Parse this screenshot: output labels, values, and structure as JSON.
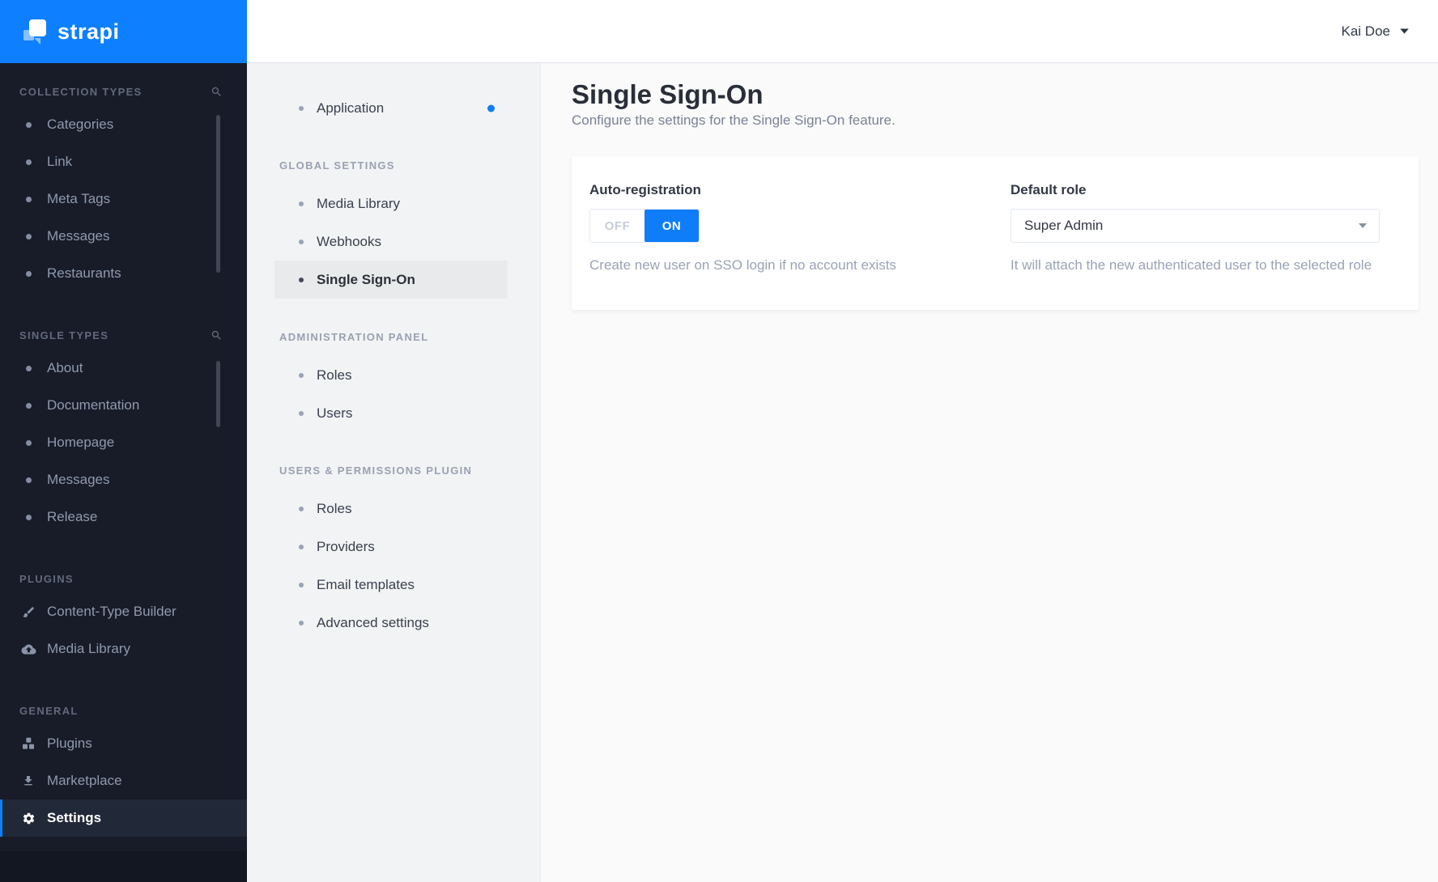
{
  "brand": {
    "name": "strapi"
  },
  "colors": {
    "brand_blue": "#0e80ff",
    "accent": "#0e7df7",
    "sidebar_bg": "#171c28",
    "settings_sidebar_bg": "#f2f3f4",
    "selected_row_bg": "#e9eaeb"
  },
  "icons": {
    "search": "magnifier",
    "content_type_builder": "brush-icon",
    "media_library": "cloud-upload-icon",
    "plugins": "cubes-icon",
    "marketplace": "download-icon",
    "settings": "gear-icon",
    "user_menu": "caret-down-icon",
    "dropdown": "caret-down-icon"
  },
  "topbar": {
    "user_name": "Kai Doe"
  },
  "sidebar": {
    "sections": [
      {
        "title": "COLLECTION TYPES",
        "has_search": true,
        "items": [
          {
            "label": "Categories"
          },
          {
            "label": "Link"
          },
          {
            "label": "Meta Tags"
          },
          {
            "label": "Messages"
          },
          {
            "label": "Restaurants"
          }
        ]
      },
      {
        "title": "SINGLE TYPES",
        "has_search": true,
        "items": [
          {
            "label": "About"
          },
          {
            "label": "Documentation"
          },
          {
            "label": "Homepage"
          },
          {
            "label": "Messages"
          },
          {
            "label": "Release"
          }
        ]
      },
      {
        "title": "PLUGINS",
        "items": [
          {
            "label": "Content-Type Builder",
            "icon": "brush-icon"
          },
          {
            "label": "Media Library",
            "icon": "cloud-upload-icon"
          }
        ]
      },
      {
        "title": "GENERAL",
        "items": [
          {
            "label": "Plugins",
            "icon": "cubes-icon"
          },
          {
            "label": "Marketplace",
            "icon": "download-icon"
          },
          {
            "label": "Settings",
            "icon": "gear-icon",
            "active": true
          }
        ]
      }
    ]
  },
  "settings_menu": {
    "groups": [
      {
        "title": "",
        "items": [
          {
            "label": "Application",
            "notification": true
          }
        ]
      },
      {
        "title": "GLOBAL SETTINGS",
        "items": [
          {
            "label": "Media Library"
          },
          {
            "label": "Webhooks"
          },
          {
            "label": "Single Sign-On",
            "selected": true
          }
        ]
      },
      {
        "title": "ADMINISTRATION PANEL",
        "items": [
          {
            "label": "Roles"
          },
          {
            "label": "Users"
          }
        ]
      },
      {
        "title": "USERS & PERMISSIONS PLUGIN",
        "items": [
          {
            "label": "Roles"
          },
          {
            "label": "Providers"
          },
          {
            "label": "Email templates"
          },
          {
            "label": "Advanced settings"
          }
        ]
      }
    ]
  },
  "page": {
    "title": "Single Sign-On",
    "subtitle": "Configure the settings for the Single Sign-On feature.",
    "form": {
      "auto_registration": {
        "label": "Auto-registration",
        "off_label": "OFF",
        "on_label": "ON",
        "value": "ON",
        "description": "Create new user on SSO login if no account exists"
      },
      "default_role": {
        "label": "Default role",
        "value": "Super Admin",
        "description": "It will attach the new authenticated user to the selected role"
      }
    }
  }
}
